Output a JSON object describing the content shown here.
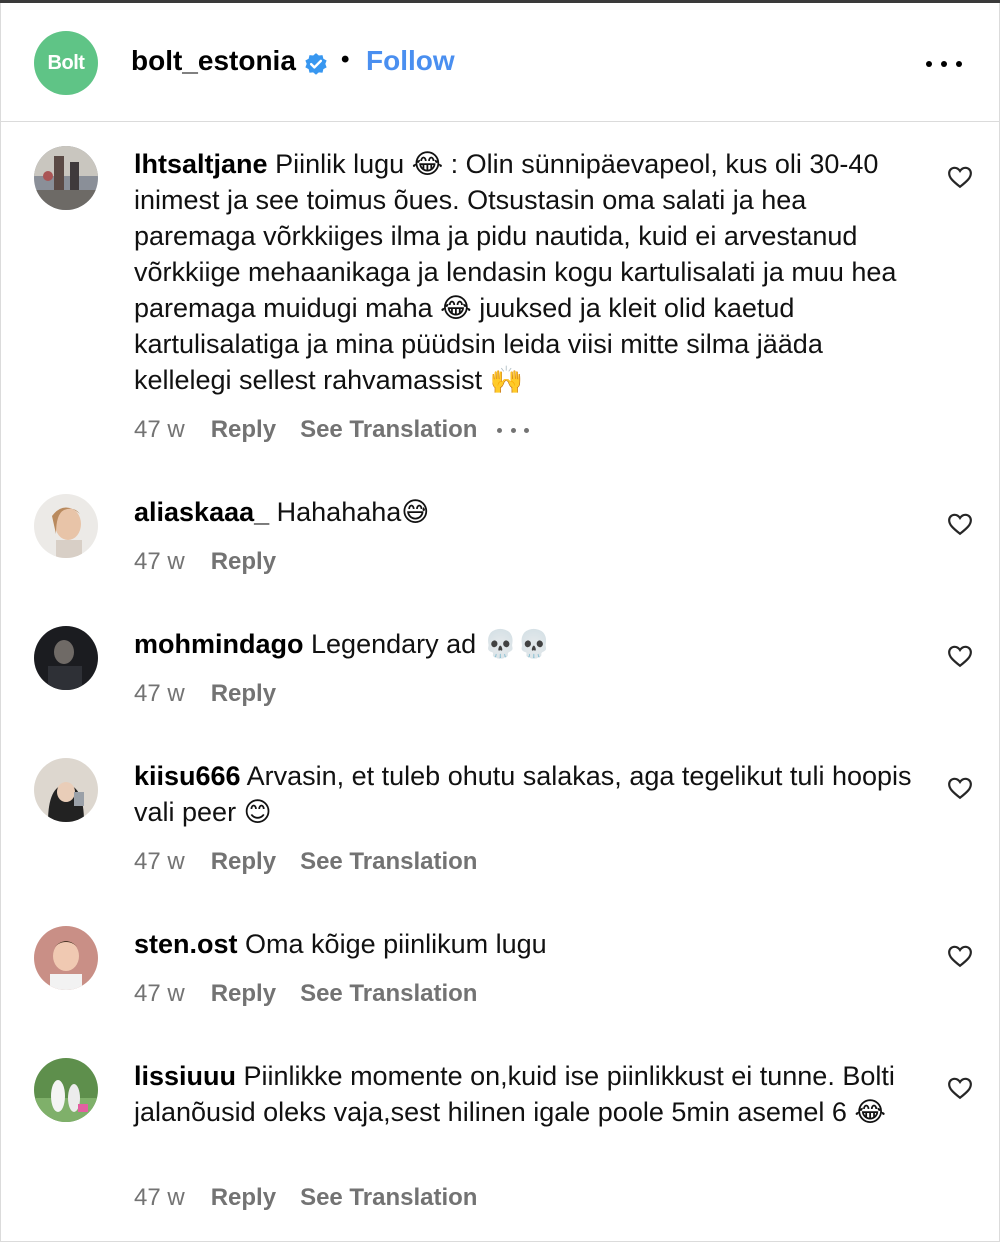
{
  "header": {
    "logo_text": "Bolt",
    "username": "bolt_estonia",
    "separator": "•",
    "follow_label": "Follow"
  },
  "comments": [
    {
      "user": "lhtsaltjane",
      "text": "Piinlik lugu 😂 : Olin sünnipäevapeol, kus oli 30-40 inimest ja see toimus õues. Otsustasin oma salati ja hea paremaga võrkkiiges ilma ja pidu nautida, kuid ei arvestanud võrkkiige mehaanikaga ja lendasin kogu kartulisalati ja muu hea paremaga muidugi maha 😂 juuksed ja kleit olid kaetud kartulisalatiga ja mina püüdsin leida viisi mitte silma jääda kellelegi sellest rahvamassist 🙌",
      "age": "47 w",
      "reply": "Reply",
      "translation": "See Translation"
    },
    {
      "user": "aliaskaaa_",
      "text": "Hahahaha😅",
      "age": "47 w",
      "reply": "Reply"
    },
    {
      "user": "mohmindago",
      "text": "Legendary ad 💀💀",
      "age": "47 w",
      "reply": "Reply"
    },
    {
      "user": "kiisu666",
      "text": "Arvasin, et tuleb ohutu salakas, aga tegelikut tuli hoopis vali peer 😊",
      "age": "47 w",
      "reply": "Reply",
      "translation": "See Translation"
    },
    {
      "user": "sten.ost",
      "text": "Oma kõige piinlikum lugu",
      "age": "47 w",
      "reply": "Reply",
      "translation": "See Translation"
    },
    {
      "user": "lissiuuu",
      "text": "Piinlikke momente on,kuid ise piinlikkust ei tunne. Bolti jalanõusid oleks vaja,sest hilinen igale poole 5min asemel 6 😂",
      "age": "47 w",
      "reply": "Reply",
      "translation": "See Translation"
    }
  ],
  "colors": {
    "brand_green": "#5fc486",
    "follow_blue": "#4a8ff0",
    "verified_blue": "#3897f0",
    "meta_gray": "#737373"
  },
  "icons": [
    "verified-badge-icon",
    "more-options-icon",
    "heart-icon"
  ]
}
